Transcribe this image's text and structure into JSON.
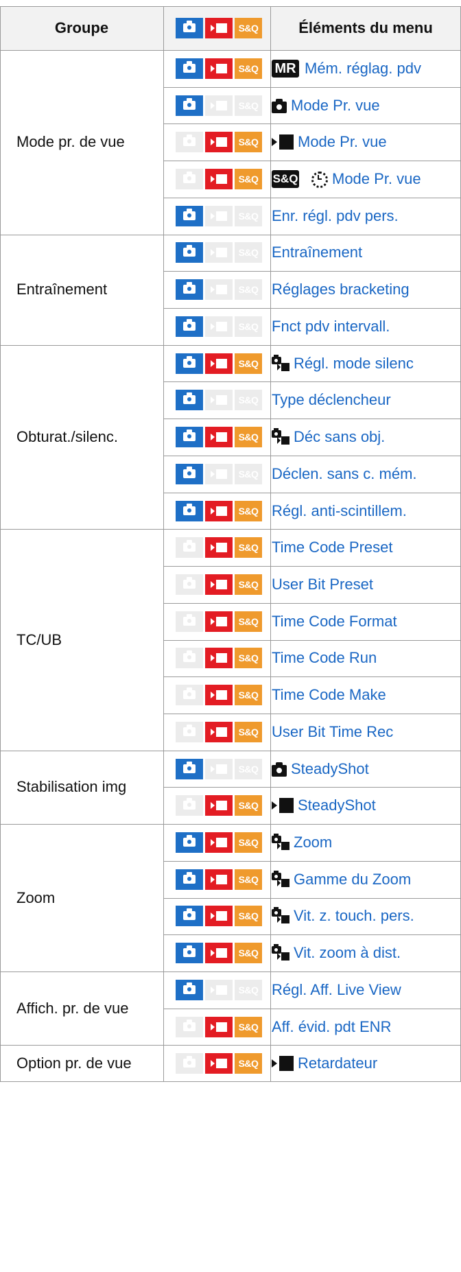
{
  "header": {
    "group": "Groupe",
    "modes_icons": [
      "photo-mode-icon",
      "movie-mode-icon",
      "s-and-q-mode-icon"
    ],
    "items": "Éléments du menu"
  },
  "mode_labels": {
    "sq": "S&Q"
  },
  "icon_labels": {
    "mr": "MR",
    "sq": "S&Q"
  },
  "colors": {
    "photo": "#1e6fc6",
    "movie": "#e31c23",
    "sq": "#ef9a2d",
    "inactive": "#ececec",
    "link": "#1a67c4",
    "border": "#9a9a9a"
  },
  "groups": [
    {
      "name": "Mode pr. de vue",
      "rows": [
        {
          "modes": [
            true,
            true,
            true
          ],
          "icon": "mr",
          "label": "Mém. réglag. pdv"
        },
        {
          "modes": [
            true,
            false,
            false
          ],
          "icon": "camera",
          "label": "Mode Pr. vue"
        },
        {
          "modes": [
            false,
            true,
            true
          ],
          "icon": "movie",
          "label": "Mode Pr. vue"
        },
        {
          "modes": [
            false,
            true,
            true
          ],
          "icon": "sq-dial",
          "label": "Mode Pr. vue"
        },
        {
          "modes": [
            true,
            false,
            false
          ],
          "icon": "",
          "label": "Enr. régl. pdv pers."
        }
      ]
    },
    {
      "name": "Entraînement",
      "rows": [
        {
          "modes": [
            true,
            false,
            false
          ],
          "icon": "",
          "label": "Entraînement"
        },
        {
          "modes": [
            true,
            false,
            false
          ],
          "icon": "",
          "label": "Réglages bracketing"
        },
        {
          "modes": [
            true,
            false,
            false
          ],
          "icon": "",
          "label": "Fnct pdv intervall."
        }
      ]
    },
    {
      "name": "Obturat./silenc.",
      "rows": [
        {
          "modes": [
            true,
            true,
            true
          ],
          "icon": "photo-movie",
          "label": "Régl. mode silenc"
        },
        {
          "modes": [
            true,
            false,
            false
          ],
          "icon": "",
          "label": "Type déclencheur"
        },
        {
          "modes": [
            true,
            true,
            true
          ],
          "icon": "photo-movie",
          "label": "Déc sans obj."
        },
        {
          "modes": [
            true,
            false,
            false
          ],
          "icon": "",
          "label": "Déclen. sans c. mém."
        },
        {
          "modes": [
            true,
            true,
            true
          ],
          "icon": "",
          "label": "Régl. anti-scintillem."
        }
      ]
    },
    {
      "name": "TC/UB",
      "rows": [
        {
          "modes": [
            false,
            true,
            true
          ],
          "icon": "",
          "label": "Time Code Preset"
        },
        {
          "modes": [
            false,
            true,
            true
          ],
          "icon": "",
          "label": "User Bit Preset"
        },
        {
          "modes": [
            false,
            true,
            true
          ],
          "icon": "",
          "label": "Time Code Format"
        },
        {
          "modes": [
            false,
            true,
            true
          ],
          "icon": "",
          "label": "Time Code Run"
        },
        {
          "modes": [
            false,
            true,
            true
          ],
          "icon": "",
          "label": "Time Code Make"
        },
        {
          "modes": [
            false,
            true,
            true
          ],
          "icon": "",
          "label": "User Bit Time Rec"
        }
      ]
    },
    {
      "name": "Stabilisation img",
      "rows": [
        {
          "modes": [
            true,
            false,
            false
          ],
          "icon": "camera",
          "label": "SteadyShot"
        },
        {
          "modes": [
            false,
            true,
            true
          ],
          "icon": "movie",
          "label": "SteadyShot"
        }
      ]
    },
    {
      "name": "Zoom",
      "rows": [
        {
          "modes": [
            true,
            true,
            true
          ],
          "icon": "photo-movie",
          "label": "Zoom"
        },
        {
          "modes": [
            true,
            true,
            true
          ],
          "icon": "photo-movie",
          "label": "Gamme du Zoom"
        },
        {
          "modes": [
            true,
            true,
            true
          ],
          "icon": "photo-movie",
          "label": "Vit. z. touch. pers."
        },
        {
          "modes": [
            true,
            true,
            true
          ],
          "icon": "photo-movie",
          "label": "Vit. zoom à dist."
        }
      ]
    },
    {
      "name": "Affich. pr. de vue",
      "rows": [
        {
          "modes": [
            true,
            false,
            false
          ],
          "icon": "",
          "label": "Régl. Aff. Live View"
        },
        {
          "modes": [
            false,
            true,
            true
          ],
          "icon": "",
          "label": "Aff. évid. pdt ENR"
        }
      ]
    },
    {
      "name": "Option pr. de vue",
      "rows": [
        {
          "modes": [
            false,
            true,
            true
          ],
          "icon": "movie",
          "label": "Retardateur"
        }
      ]
    }
  ]
}
